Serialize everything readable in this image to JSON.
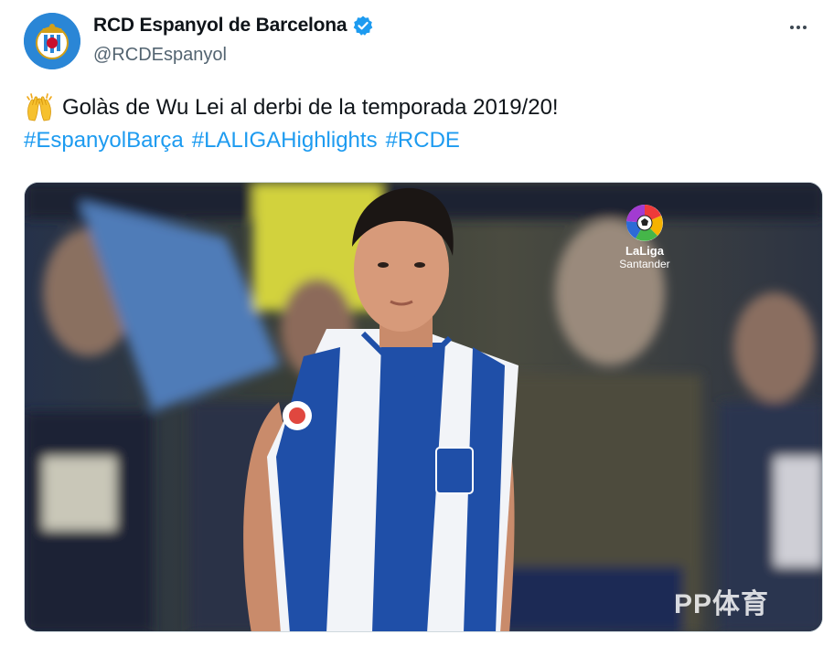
{
  "tweet": {
    "display_name": "RCD Espanyol de Barcelona",
    "handle": "@RCDEspanyol",
    "text": "Golàs de Wu Lei al derbi de la temporada 2019/20!",
    "hashtags": [
      "#EspanyolBarça",
      "#LALIGAHighlights",
      "#RCDE"
    ],
    "emoji": "raising-hands",
    "verified": true,
    "more_icon": "ellipsis-icon"
  },
  "media": {
    "overlay_logo_name": "LaLiga",
    "overlay_logo_sponsor": "Santander",
    "watermark": "PP体育"
  },
  "colors": {
    "link": "#1d9bf0",
    "text": "#0f1419",
    "secondary": "#536471",
    "verified": "#1d9bf0",
    "avatar_bg": "#2a86d6"
  }
}
